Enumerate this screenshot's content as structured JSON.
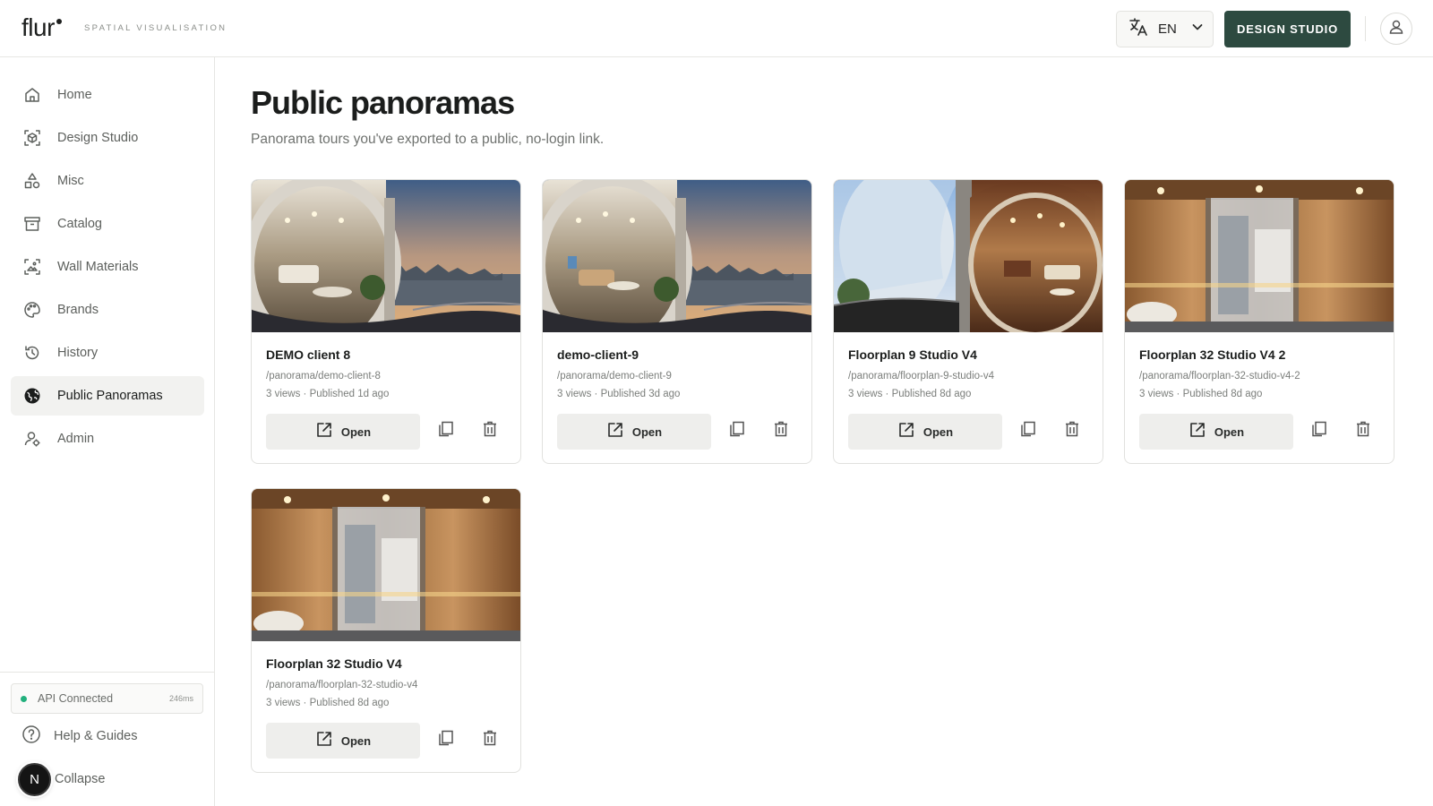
{
  "brand": {
    "logo": "flur",
    "tagline": "SPATIAL VISUALISATION"
  },
  "header": {
    "language": "EN",
    "studio_button": "DESIGN STUDIO",
    "icons": [
      "translate-icon",
      "chevron-down-icon",
      "user-icon"
    ]
  },
  "sidebar": {
    "items": [
      {
        "label": "Home",
        "icon": "home-icon",
        "active": false
      },
      {
        "label": "Design Studio",
        "icon": "cube-scan-icon",
        "active": false
      },
      {
        "label": "Misc",
        "icon": "shapes-icon",
        "active": false
      },
      {
        "label": "Catalog",
        "icon": "archive-icon",
        "active": false
      },
      {
        "label": "Wall Materials",
        "icon": "wall-image-icon",
        "active": false
      },
      {
        "label": "Brands",
        "icon": "palette-icon",
        "active": false
      },
      {
        "label": "History",
        "icon": "history-icon",
        "active": false
      },
      {
        "label": "Public Panoramas",
        "icon": "globe-icon",
        "active": true
      },
      {
        "label": "Admin",
        "icon": "admin-user-icon",
        "active": false
      }
    ],
    "api_status": {
      "label": "API Connected",
      "latency": "246ms",
      "color": "#22b07d"
    },
    "help": "Help & Guides",
    "collapse": "Collapse",
    "badge": "N"
  },
  "main": {
    "title": "Public panoramas",
    "subtitle": "Panorama tours you've exported to a public, no-login link.",
    "open_label": "Open",
    "cards": [
      {
        "title": "DEMO client 8",
        "path": "/panorama/demo-client-8",
        "meta": "3 views · Published 1d ago",
        "scene": "living-city"
      },
      {
        "title": "demo-client-9",
        "path": "/panorama/demo-client-9",
        "meta": "3 views · Published 3d ago",
        "scene": "living-city"
      },
      {
        "title": "Floorplan 9 Studio V4",
        "path": "/panorama/floorplan-9-studio-v4",
        "meta": "3 views · Published 8d ago",
        "scene": "studio-sky"
      },
      {
        "title": "Floorplan 32 Studio V4 2",
        "path": "/panorama/floorplan-32-studio-v4-2",
        "meta": "3 views · Published 8d ago",
        "scene": "wood-bath"
      },
      {
        "title": "Floorplan 32 Studio V4",
        "path": "/panorama/floorplan-32-studio-v4",
        "meta": "3 views · Published 8d ago",
        "scene": "wood-bath"
      }
    ]
  },
  "colors": {
    "accent": "#2d4a40",
    "active_nav": "#f2f2f0"
  }
}
